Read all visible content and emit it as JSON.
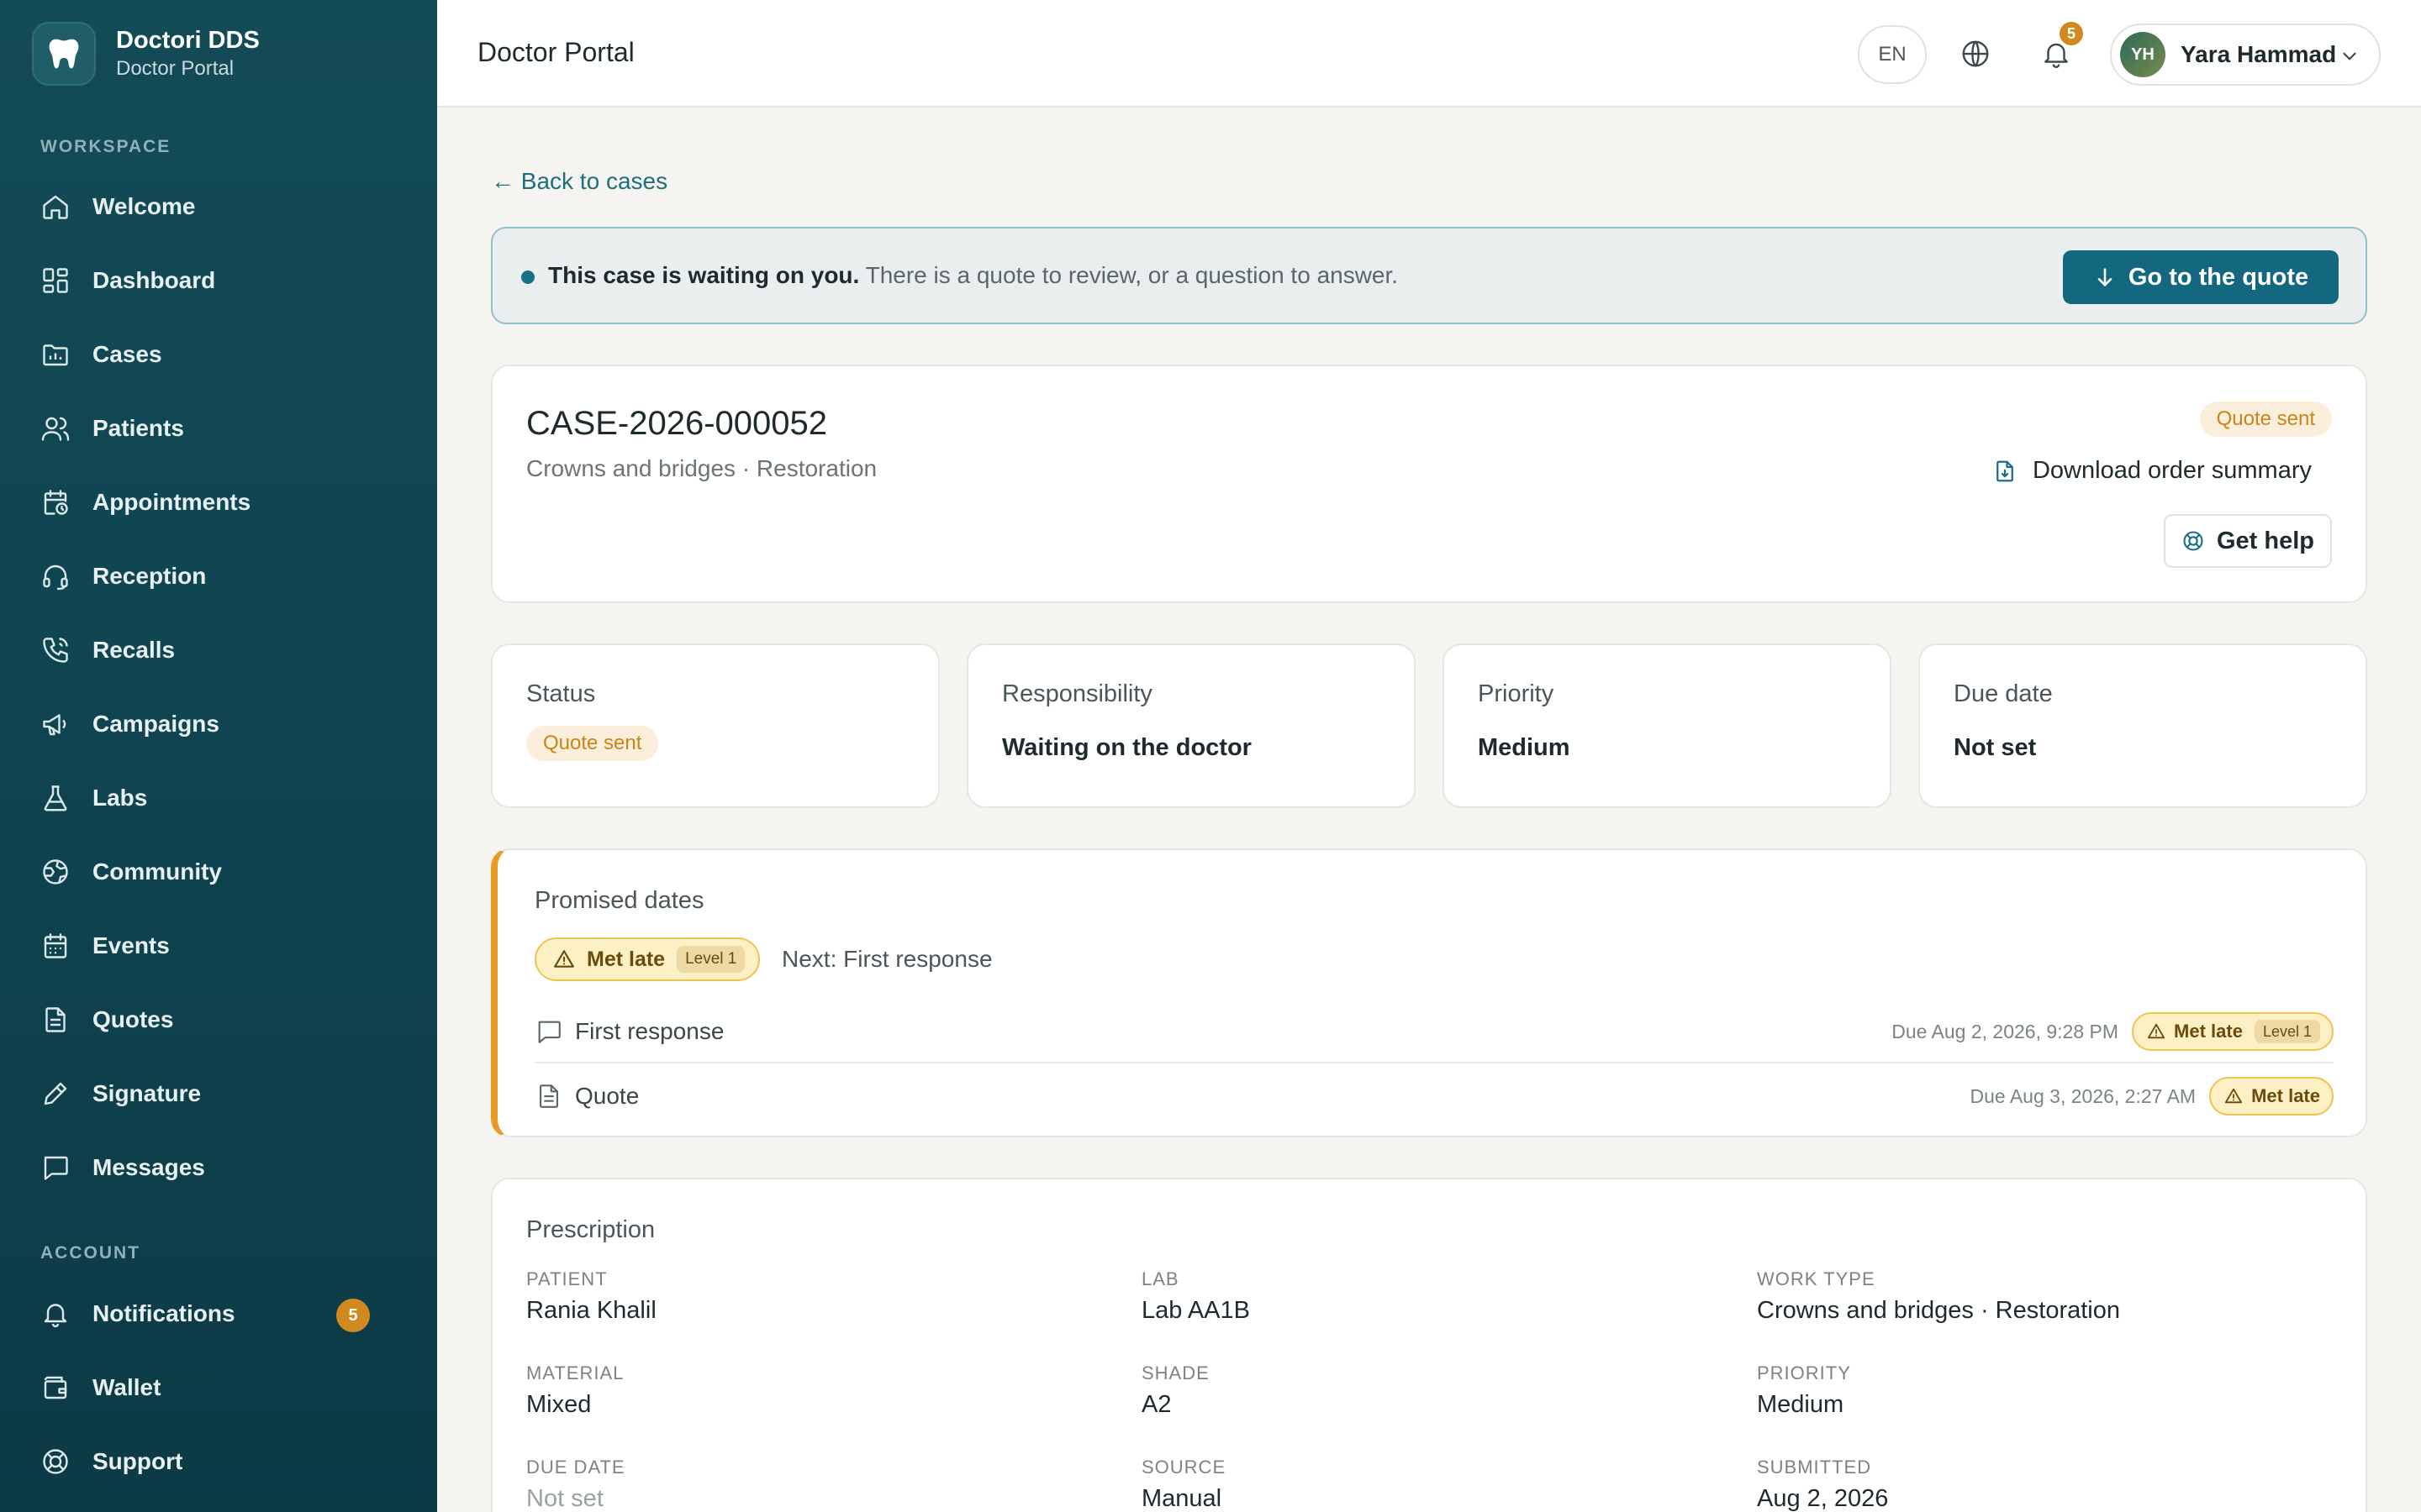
{
  "brand": {
    "name": "Doctori DDS",
    "subtitle": "Doctor Portal"
  },
  "sidebar": {
    "workspace_label": "WORKSPACE",
    "account_label": "ACCOUNT",
    "items": [
      {
        "label": "Welcome",
        "icon": "home-icon"
      },
      {
        "label": "Dashboard",
        "icon": "dashboard-icon"
      },
      {
        "label": "Cases",
        "icon": "folder-icon"
      },
      {
        "label": "Patients",
        "icon": "users-icon"
      },
      {
        "label": "Appointments",
        "icon": "calendar-clock-icon"
      },
      {
        "label": "Reception",
        "icon": "headset-icon"
      },
      {
        "label": "Recalls",
        "icon": "phone-icon"
      },
      {
        "label": "Campaigns",
        "icon": "megaphone-icon"
      },
      {
        "label": "Labs",
        "icon": "flask-icon"
      },
      {
        "label": "Community",
        "icon": "globe-icon"
      },
      {
        "label": "Events",
        "icon": "calendar-icon"
      },
      {
        "label": "Quotes",
        "icon": "document-icon"
      },
      {
        "label": "Signature",
        "icon": "pen-icon"
      },
      {
        "label": "Messages",
        "icon": "message-icon"
      }
    ],
    "account_items": [
      {
        "label": "Notifications",
        "icon": "bell-icon",
        "badge": "5"
      },
      {
        "label": "Wallet",
        "icon": "wallet-icon"
      },
      {
        "label": "Support",
        "icon": "lifebuoy-icon"
      }
    ]
  },
  "topbar": {
    "title": "Doctor Portal",
    "lang": "EN",
    "notif_count": "5",
    "user": {
      "initials": "YH",
      "name": "Yara Hammad"
    }
  },
  "main": {
    "back_link": "← Back to cases",
    "alert": {
      "strong": "This case is waiting on you.",
      "text": " There is a quote to review, or a question to answer.",
      "button": "Go to the quote"
    },
    "case": {
      "id": "CASE-2026-000052",
      "subtitle": "Crowns and bridges · Restoration",
      "status_chip": "Quote sent",
      "download": "Download order summary",
      "help": "Get help"
    },
    "stats": {
      "status": {
        "label": "Status",
        "value": "Quote sent"
      },
      "responsibility": {
        "label": "Responsibility",
        "value": "Waiting on the doctor"
      },
      "priority": {
        "label": "Priority",
        "value": "Medium"
      },
      "due_date": {
        "label": "Due date",
        "value": "Not set"
      }
    },
    "promised": {
      "title": "Promised dates",
      "overall_chip": "Met late",
      "overall_level": "Level 1",
      "next": "Next: First response",
      "rows": [
        {
          "name": "First response",
          "due": "Due Aug 2, 2026, 9:28 PM",
          "chip": "Met late",
          "level": "Level 1"
        },
        {
          "name": "Quote",
          "due": "Due Aug 3, 2026, 2:27 AM",
          "chip": "Met late"
        }
      ]
    },
    "prescription": {
      "title": "Prescription",
      "fields": [
        {
          "label": "PATIENT",
          "value": "Rania Khalil"
        },
        {
          "label": "LAB",
          "value": "Lab AA1B"
        },
        {
          "label": "WORK TYPE",
          "value": "Crowns and bridges · Restoration"
        },
        {
          "label": "MATERIAL",
          "value": "Mixed"
        },
        {
          "label": "SHADE",
          "value": "A2"
        },
        {
          "label": "PRIORITY",
          "value": "Medium"
        },
        {
          "label": "DUE DATE",
          "value": "Not set"
        },
        {
          "label": "SOURCE",
          "value": "Manual"
        },
        {
          "label": "SUBMITTED",
          "value": "Aug 2, 2026"
        }
      ]
    }
  }
}
